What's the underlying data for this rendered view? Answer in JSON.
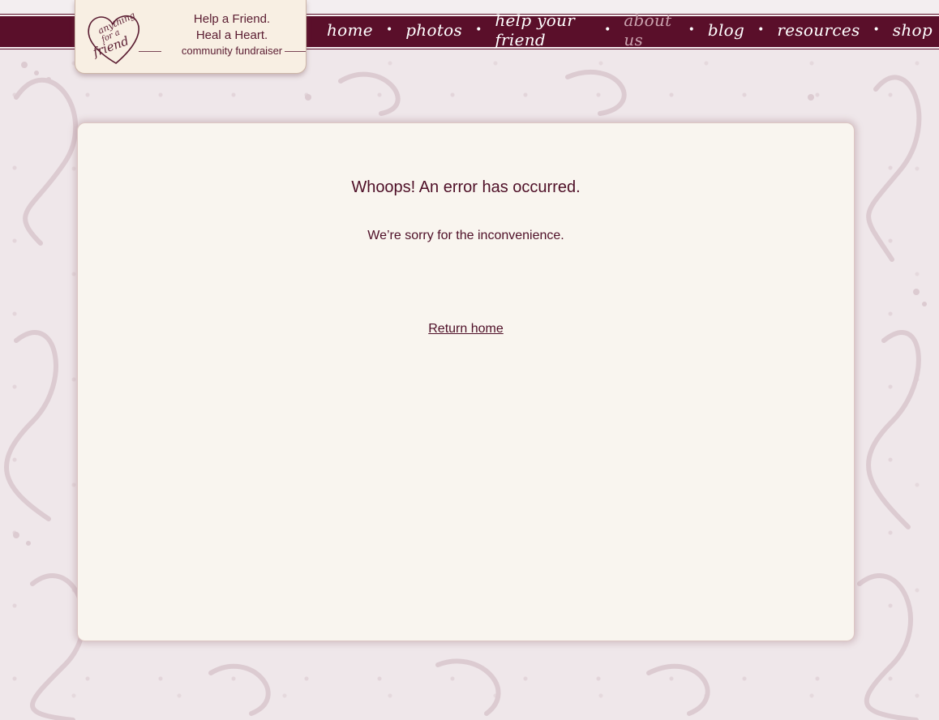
{
  "logo": {
    "line1": "anything",
    "line2": "for a",
    "line3": "friend",
    "tagline1": "Help a Friend.",
    "tagline2": "Heal a Heart.",
    "tagline3": "community fundraiser"
  },
  "nav": {
    "items": [
      {
        "label": "home"
      },
      {
        "label": "photos"
      },
      {
        "label": "help your friend"
      },
      {
        "label": "about us"
      },
      {
        "label": "blog"
      },
      {
        "label": "resources"
      },
      {
        "label": "shop"
      }
    ],
    "separator": "•"
  },
  "error": {
    "title": "Whoops! An error has occurred.",
    "message": "We’re sorry for the inconvenience.",
    "return_link": "Return home"
  },
  "colors": {
    "brand": "#5a0f2a",
    "text": "#4e0f27",
    "panel": "#f9f5ef",
    "background": "#efe7ea"
  }
}
